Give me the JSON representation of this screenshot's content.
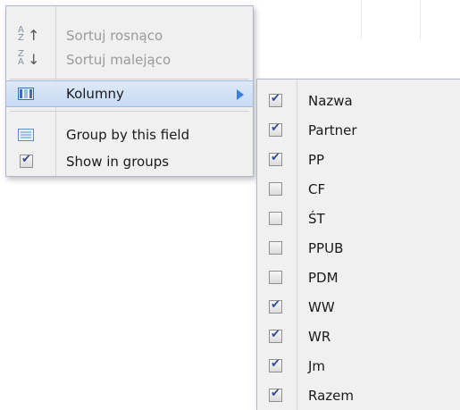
{
  "menu": {
    "sort_asc": {
      "label": "Sortuj rosnąco",
      "icon": "sort-az-icon",
      "top_letter": "A",
      "bottom_letter": "Z",
      "arrow": "↑",
      "enabled": false
    },
    "sort_desc": {
      "label": "Sortuj malejąco",
      "icon": "sort-za-icon",
      "top_letter": "Z",
      "bottom_letter": "A",
      "arrow": "↓",
      "enabled": false
    },
    "columns": {
      "label": "Kolumny",
      "icon": "columns-icon",
      "highlighted": true
    },
    "group_by": {
      "label": "Group by this field",
      "icon": "group-icon"
    },
    "show_groups": {
      "label": "Show in groups",
      "checked": true
    }
  },
  "submenu": {
    "columns": [
      {
        "label": "Nazwa",
        "checked": true
      },
      {
        "label": "Partner",
        "checked": true
      },
      {
        "label": "PP",
        "checked": true
      },
      {
        "label": "CF",
        "checked": false
      },
      {
        "label": "ŚT",
        "checked": false
      },
      {
        "label": "PPUB",
        "checked": false
      },
      {
        "label": "PDM",
        "checked": false
      },
      {
        "label": "WW",
        "checked": true
      },
      {
        "label": "WR",
        "checked": true
      },
      {
        "label": "Jm",
        "checked": true
      },
      {
        "label": "Razem",
        "checked": true
      }
    ]
  },
  "colors": {
    "accent": "#3c7fd6",
    "highlight": "#c7dbf4",
    "menu_bg": "#f0f0f0"
  }
}
